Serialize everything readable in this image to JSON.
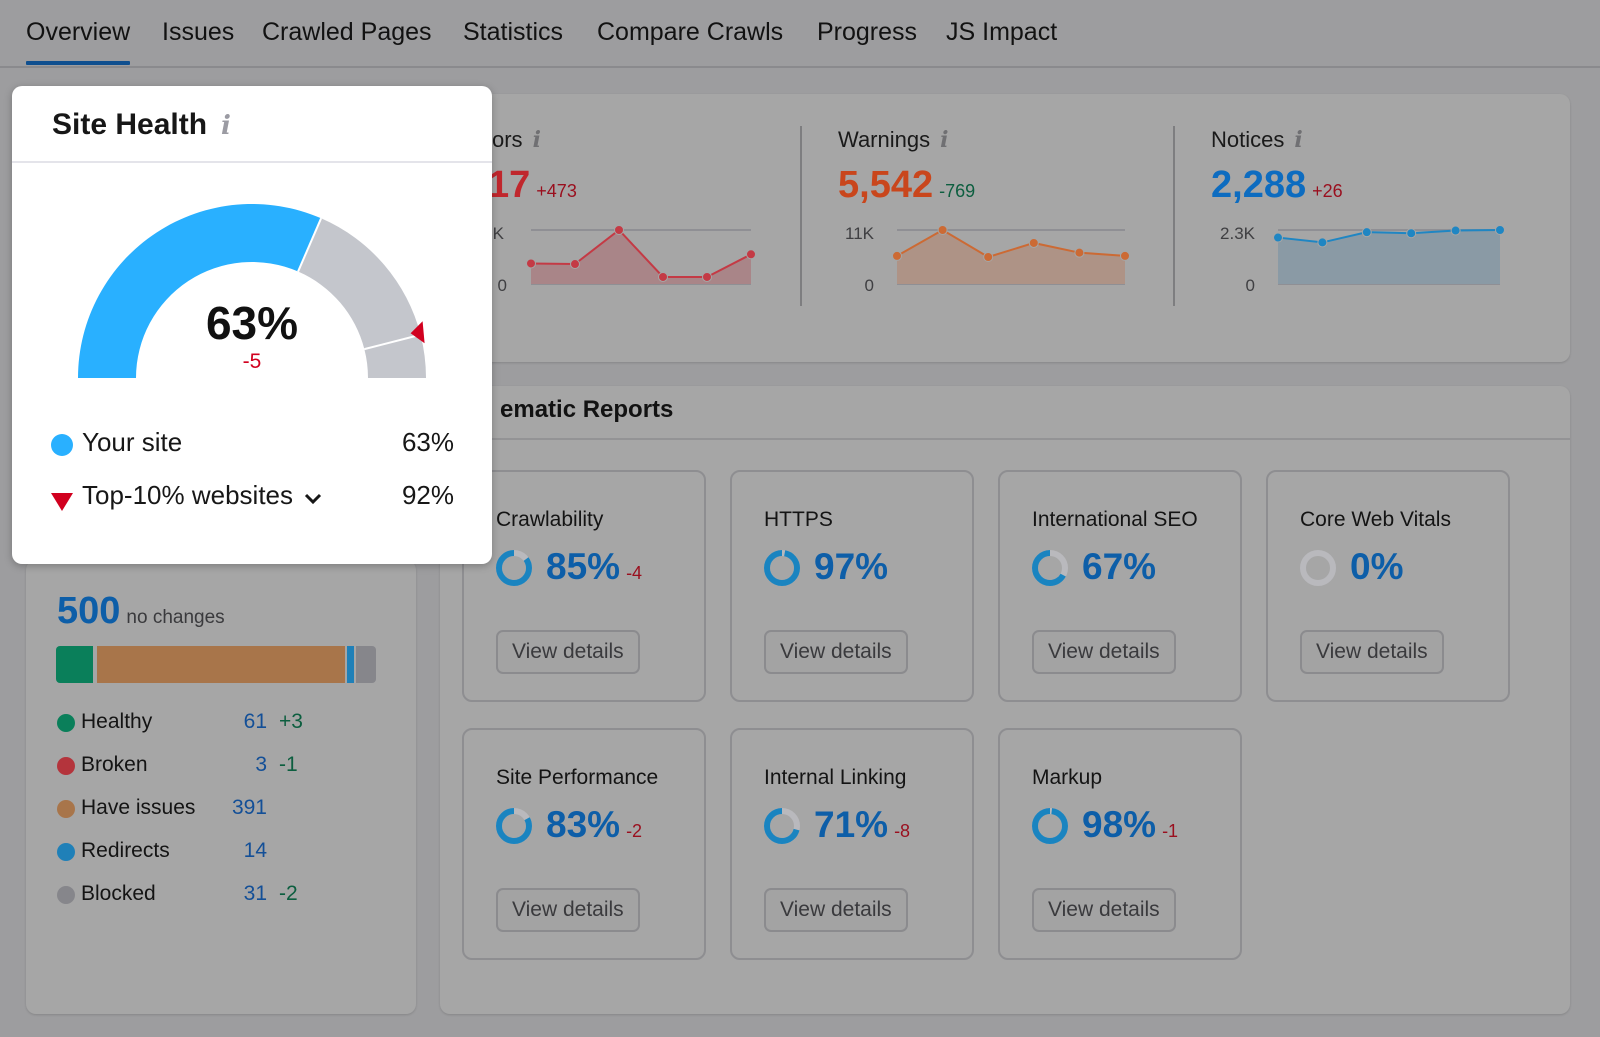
{
  "tabs": [
    {
      "label": "Overview",
      "active": true
    },
    {
      "label": "Issues",
      "active": false
    },
    {
      "label": "Crawled Pages",
      "active": false
    },
    {
      "label": "Statistics",
      "active": false
    },
    {
      "label": "Compare Crawls",
      "active": false
    },
    {
      "label": "Progress",
      "active": false
    },
    {
      "label": "JS Impact",
      "active": false
    }
  ],
  "site_health": {
    "title": "Site Health",
    "info_icon": "info-icon",
    "value": "63%",
    "value_fraction": 0.63,
    "top10_fraction": 0.92,
    "delta": "-5",
    "legend": [
      {
        "label": "Your site",
        "value": "63%",
        "marker": "circle",
        "color": "#29b0ff"
      },
      {
        "label": "Top-10% websites",
        "value": "92%",
        "marker": "triangle-down",
        "color": "#d1001f",
        "has_dropdown": true
      }
    ],
    "colors": {
      "fill": "#29b0ff",
      "rest": "#c4c6cc",
      "marker": "#d1001f"
    }
  },
  "issues": [
    {
      "label": "Errors",
      "visible_label": "ors",
      "value": "17",
      "delta": "+473",
      "value_color": "#c0272d",
      "delta_color": "#9a0f1e",
      "y_max_label": "K",
      "y_min_label": "0",
      "line_color": "#c43a45",
      "fill_color": "#a98588",
      "trend": [
        0.38,
        0.37,
        1.0,
        0.13,
        0.13,
        0.55
      ]
    },
    {
      "label": "Warnings",
      "visible_label": "Warnings",
      "value": "5,542",
      "delta": "-769",
      "value_color": "#c9461c",
      "delta_color": "#0c5e3f",
      "y_max_label": "11K",
      "y_min_label": "0",
      "line_color": "#cc6a34",
      "fill_color": "#ae9386",
      "trend": [
        0.52,
        1.0,
        0.5,
        0.76,
        0.58,
        0.52
      ]
    },
    {
      "label": "Notices",
      "visible_label": "Notices",
      "value": "2,288",
      "delta": "+26",
      "value_color": "#0d6cc0",
      "delta_color": "#9a0f1e",
      "y_max_label": "2.3K",
      "y_min_label": "0",
      "line_color": "#1f86c3",
      "fill_color": "#8a9aa5",
      "trend": [
        0.86,
        0.77,
        0.96,
        0.94,
        0.99,
        1.0
      ]
    }
  ],
  "crawled_pages": {
    "total": "500",
    "subtitle": "no changes",
    "segments": [
      {
        "label": "Healthy",
        "count": "61",
        "value": 61,
        "delta": "+3",
        "color": "#0a7f5a"
      },
      {
        "label": "Broken",
        "count": "3",
        "value": 3,
        "delta": "-1",
        "color": "#b4343c"
      },
      {
        "label": "Have issues",
        "count": "391",
        "value": 391,
        "delta": "",
        "color": "#a8754a"
      },
      {
        "label": "Redirects",
        "count": "14",
        "value": 14,
        "delta": "",
        "color": "#1f80b8"
      },
      {
        "label": "Blocked",
        "count": "31",
        "value": 31,
        "delta": "-2",
        "color": "#86868b"
      }
    ]
  },
  "thematic_reports": {
    "title": "Thematic Reports",
    "visible_title": "ematic Reports",
    "button_label": "View details",
    "reports": [
      {
        "name": "Crawlability",
        "value": "85%",
        "fraction": 0.85,
        "delta": "-4"
      },
      {
        "name": "HTTPS",
        "value": "97%",
        "fraction": 0.97,
        "delta": ""
      },
      {
        "name": "International SEO",
        "value": "67%",
        "fraction": 0.67,
        "delta": ""
      },
      {
        "name": "Core Web Vitals",
        "value": "0%",
        "fraction": 0.0,
        "delta": ""
      },
      {
        "name": "Site Performance",
        "value": "83%",
        "fraction": 0.83,
        "delta": "-2"
      },
      {
        "name": "Internal Linking",
        "value": "71%",
        "fraction": 0.71,
        "delta": "-8"
      },
      {
        "name": "Markup",
        "value": "98%",
        "fraction": 0.98,
        "delta": "-1"
      }
    ],
    "donut_colors": {
      "fill": "#1a84c0",
      "rest": "#b9b9bd"
    }
  }
}
